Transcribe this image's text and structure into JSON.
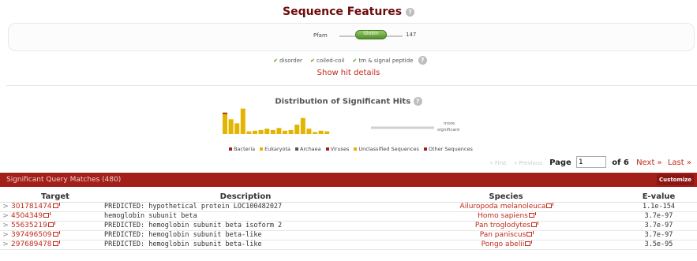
{
  "features": {
    "title": "Sequence Features",
    "pfam_label": "Pfam",
    "domain_label": "Globin",
    "length_label": "147",
    "legend": [
      "disorder",
      "coiled-coil",
      "tm & signal peptide"
    ],
    "show_details": "Show hit details"
  },
  "distribution": {
    "title": "Distribution of Significant Hits",
    "more_label": "more significant",
    "legend": [
      {
        "label": "Bacteria",
        "color": "#a31f1a"
      },
      {
        "label": "Eukaryota",
        "color": "#e3b400"
      },
      {
        "label": "Archaea",
        "color": "#555555"
      },
      {
        "label": "Viruses",
        "color": "#a31f1a"
      },
      {
        "label": "Unclassified Sequences",
        "color": "#e3b400"
      },
      {
        "label": "Other Sequences",
        "color": "#a31f1a"
      }
    ]
  },
  "chart_data": {
    "type": "bar",
    "title": "Distribution of Significant Hits",
    "series": [
      {
        "name": "Eukaryota",
        "values": [
          30,
          22,
          16,
          38,
          4,
          5,
          6,
          8,
          6,
          9,
          5,
          6,
          14,
          24,
          8,
          3,
          5,
          4
        ]
      },
      {
        "name": "Bacteria",
        "values": [
          2,
          0,
          0,
          0,
          0,
          0,
          0,
          0,
          0,
          0,
          0,
          0,
          0,
          0,
          0,
          0,
          0,
          0
        ]
      }
    ],
    "ylim": [
      0,
      40
    ]
  },
  "pager": {
    "first": "« First",
    "previous": "« Previous",
    "page_label": "Page",
    "page_value": "1",
    "of_label": "of 6",
    "next": "Next »",
    "last": "Last »"
  },
  "table": {
    "title": "Significant Query Matches (480)",
    "customize": "Customize",
    "headers": [
      "Target",
      "Description",
      "Species",
      "E-value"
    ],
    "rows": [
      {
        "target": "301781474",
        "description": "PREDICTED: hypothetical protein LOC100482027",
        "species": "Ailuropoda melanoleuca",
        "evalue": "1.1e-154"
      },
      {
        "target": "4504349",
        "description": "hemoglobin subunit beta",
        "species": "Homo sapiens",
        "evalue": "3.7e-97"
      },
      {
        "target": "55635219",
        "description": "PREDICTED: hemoglobin subunit beta isoform 2",
        "species": "Pan troglodytes",
        "evalue": "3.7e-97"
      },
      {
        "target": "397496509",
        "description": "PREDICTED: hemoglobin subunit beta-like",
        "species": "Pan paniscus",
        "evalue": "3.7e-97"
      },
      {
        "target": "297689478",
        "description": "PREDICTED: hemoglobin subunit beta-like",
        "species": "Pongo abelii",
        "evalue": "3.5e-95"
      }
    ]
  }
}
